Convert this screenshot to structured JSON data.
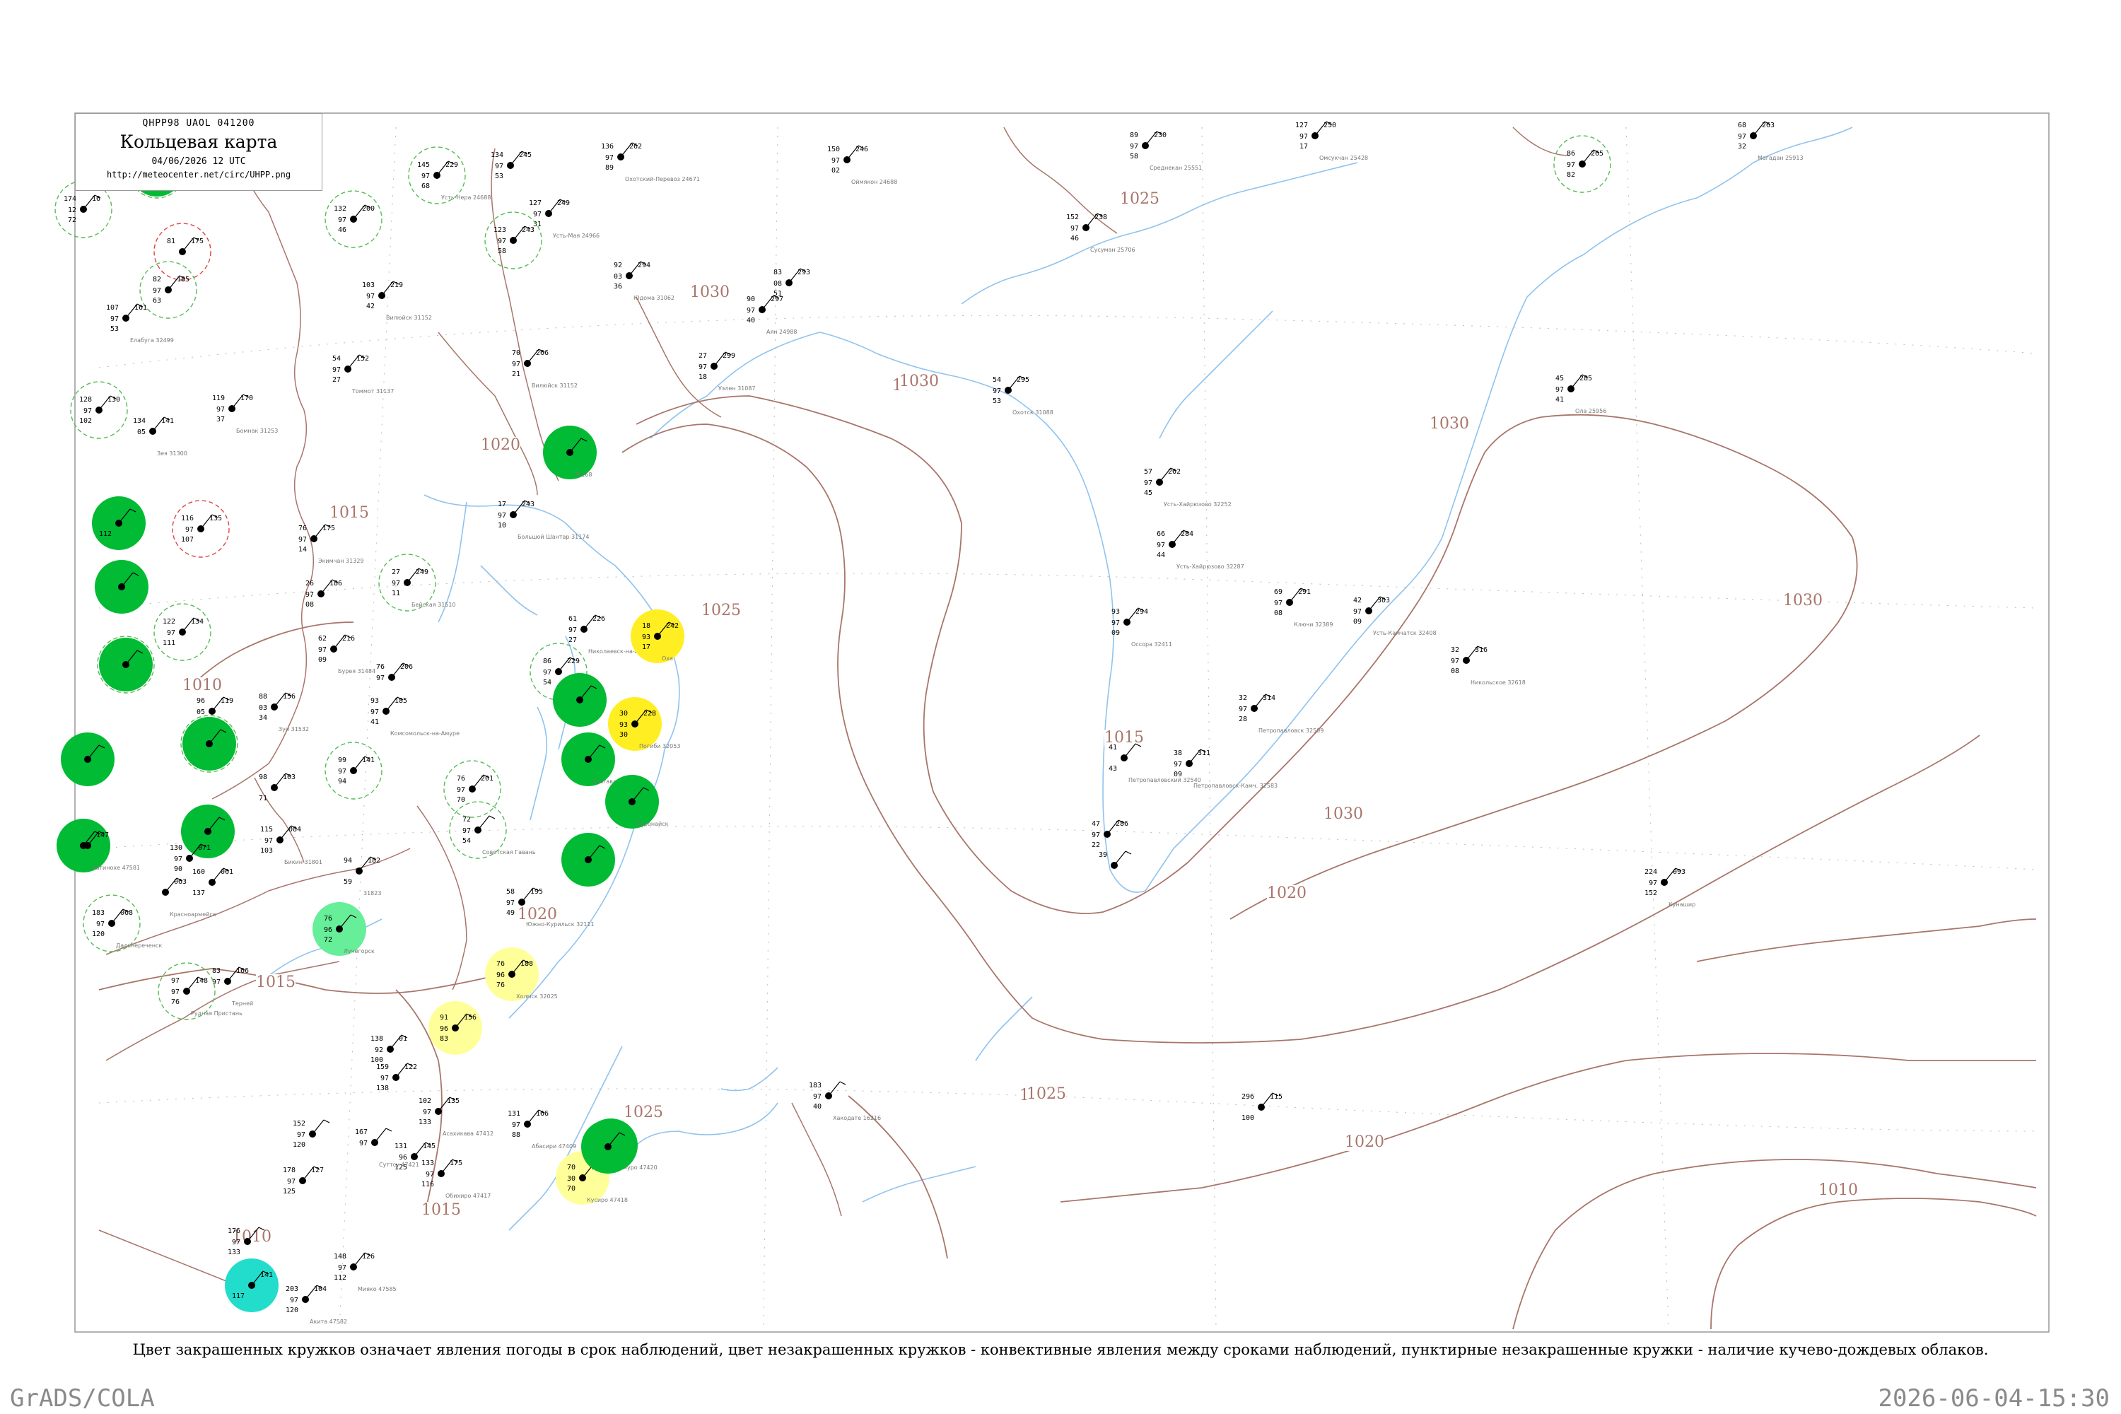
{
  "header": {
    "code": "QHPP98  UAOL  041200",
    "title": "Кольцевая карта",
    "date": "04/06/2026 12 UTC",
    "url": "http://meteocenter.net/circ/UHPP.png"
  },
  "caption": "Цвет закрашенных кружков означает явления погоды в срок наблюдений, цвет незакрашенных кружков - конвективные явления между сроками наблюдений, пунктирные незакрашенные кружки - наличие кучево-дождевых облаков.",
  "footer": {
    "left": "GrADS/COLA",
    "right": "2026-06-04-15:30"
  },
  "colors": {
    "isobar": "#a9756a",
    "coast": "#8fc3ee",
    "river": "#8fc3ee",
    "frame": "#999999",
    "rain_green": "#00bb33",
    "drizzle_light_green": "#66ee99",
    "fog_yellow": "#ffee22",
    "haze_light_yellow": "#ffff99",
    "snow_cyan": "#22ddcc",
    "cb_dashed": "#55bb55",
    "convective_red": "#dd4444"
  },
  "isobar_labels": [
    "1030",
    "1025",
    "1020",
    "1015",
    "1010",
    "1030",
    "1030",
    "1030",
    "1025",
    "1025",
    "1025",
    "1020",
    "1015",
    "1015",
    "1030",
    "1020",
    "1010",
    "1030",
    "1015",
    "1010",
    "1020",
    "1025"
  ],
  "stations": [
    {
      "id": "s1",
      "t": "174",
      "p": "16",
      "td": "72",
      "w": "12",
      "name": "",
      "fill": "none",
      "ring": "cb"
    },
    {
      "id": "s2",
      "t": "81",
      "p": "175",
      "td": "",
      "w": "",
      "name": "",
      "fill": "none",
      "ring": "red"
    },
    {
      "id": "s3",
      "t": "82",
      "p": "185",
      "td": "63",
      "w": "97",
      "name": "",
      "fill": "none",
      "ring": "cb"
    },
    {
      "id": "s4",
      "t": "107",
      "p": "161",
      "td": "53",
      "w": "97",
      "name": "Елабуга 32499",
      "fill": "none",
      "ring": ""
    },
    {
      "id": "s5",
      "t": "",
      "p": "",
      "td": "",
      "w": "",
      "name": "",
      "fill": "green",
      "ring": "cb"
    },
    {
      "id": "s6",
      "t": "145",
      "p": "229",
      "td": "68",
      "w": "97",
      "name": "Усть-Нера 24688",
      "fill": "none",
      "ring": "cb"
    },
    {
      "id": "s7",
      "t": "132",
      "p": "200",
      "td": "46",
      "w": "97",
      "name": "",
      "fill": "none",
      "ring": "cb"
    },
    {
      "id": "s8",
      "t": "134",
      "p": "245",
      "td": "53",
      "w": "97",
      "name": "",
      "fill": "none",
      "ring": ""
    },
    {
      "id": "s9",
      "t": "136",
      "p": "262",
      "td": "89",
      "w": "97",
      "name": "Охотский-Перевоз 24671",
      "fill": "none",
      "ring": ""
    },
    {
      "id": "s10",
      "t": "127",
      "p": "249",
      "td": "31",
      "w": "97",
      "name": "Усть-Мая 24966",
      "fill": "none",
      "ring": ""
    },
    {
      "id": "s11",
      "t": "123",
      "p": "243",
      "td": "58",
      "w": "97",
      "name": "",
      "fill": "none",
      "ring": "cb"
    },
    {
      "id": "s12",
      "t": "103",
      "p": "219",
      "td": "42",
      "w": "97",
      "name": "Вилюйск 31152",
      "fill": "none",
      "ring": ""
    },
    {
      "id": "s13",
      "t": "92",
      "p": "294",
      "td": "36",
      "w": "03",
      "name": "Юдома 31062",
      "fill": "none",
      "ring": ""
    },
    {
      "id": "s14",
      "t": "90",
      "p": "297",
      "td": "40",
      "w": "97",
      "name": "Аян 24988",
      "fill": "none",
      "ring": ""
    },
    {
      "id": "s15",
      "t": "83",
      "p": "293",
      "td": "51",
      "w": "08",
      "name": "",
      "fill": "none",
      "ring": ""
    },
    {
      "id": "s16",
      "t": "150",
      "p": "246",
      "td": "02",
      "w": "97",
      "name": "Оймякон 24688",
      "fill": "none",
      "ring": ""
    },
    {
      "id": "s17",
      "t": "89",
      "p": "230",
      "td": "58",
      "w": "97",
      "name": "Среднекан 25551",
      "fill": "none",
      "ring": ""
    },
    {
      "id": "s18",
      "t": "127",
      "p": "250",
      "td": "17",
      "w": "97",
      "name": "Омсукчан 25428",
      "fill": "none",
      "ring": ""
    },
    {
      "id": "s19",
      "t": "68",
      "p": "263",
      "td": "32",
      "w": "97",
      "name": "Магадан 25913",
      "fill": "none",
      "ring": ""
    },
    {
      "id": "s20",
      "t": "86",
      "p": "265",
      "td": "82",
      "w": "97",
      "name": "",
      "fill": "none",
      "ring": "cb"
    },
    {
      "id": "s21",
      "t": "152",
      "p": "238",
      "td": "46",
      "w": "97",
      "name": "Сусуман 25706",
      "fill": "none",
      "ring": ""
    },
    {
      "id": "s22",
      "t": "27",
      "p": "299",
      "td": "18",
      "w": "97",
      "name": "Уэлен 31087",
      "fill": "none",
      "ring": ""
    },
    {
      "id": "s23",
      "t": "54",
      "p": "295",
      "td": "53",
      "w": "97",
      "name": "Охотск 31088",
      "fill": "none",
      "ring": ""
    },
    {
      "id": "s24",
      "t": "70",
      "p": "266",
      "td": "21",
      "w": "97",
      "name": "Вилюйск 31152",
      "fill": "none",
      "ring": ""
    },
    {
      "id": "s25",
      "t": "54",
      "p": "152",
      "td": "27",
      "w": "97",
      "name": "Томмот 31137",
      "fill": "none",
      "ring": ""
    },
    {
      "id": "s26",
      "t": "45",
      "p": "285",
      "td": "41",
      "w": "97",
      "name": "Ола 25956",
      "fill": "none",
      "ring": ""
    },
    {
      "id": "s27",
      "t": "128",
      "p": "130",
      "td": "102",
      "w": "97",
      "name": "",
      "fill": "none",
      "ring": "cb"
    },
    {
      "id": "s28",
      "t": "134",
      "p": "141",
      "td": "",
      "w": "05",
      "name": "Зея 31300",
      "fill": "none",
      "ring": ""
    },
    {
      "id": "s29",
      "t": "119",
      "p": "170",
      "td": "37",
      "w": "97",
      "name": "Бомнак 31253",
      "fill": "none",
      "ring": ""
    },
    {
      "id": "s30",
      "t": "",
      "p": "",
      "td": "",
      "w": "",
      "name": "31168",
      "fill": "green",
      "ring": ""
    },
    {
      "id": "s31",
      "t": "",
      "p": "",
      "td": "112",
      "w": "",
      "name": "",
      "fill": "green",
      "ring": ""
    },
    {
      "id": "s32",
      "t": "116",
      "p": "135",
      "td": "107",
      "w": "97",
      "name": "",
      "fill": "none",
      "ring": "red"
    },
    {
      "id": "s33",
      "t": "76",
      "p": "175",
      "td": "14",
      "w": "97",
      "name": "Экимчан 31329",
      "fill": "none",
      "ring": ""
    },
    {
      "id": "s34",
      "t": "17",
      "p": "243",
      "td": "10",
      "w": "97",
      "name": "Большой Шантар 31174",
      "fill": "none",
      "ring": ""
    },
    {
      "id": "s35",
      "t": "57",
      "p": "262",
      "td": "45",
      "w": "97",
      "name": "Усть-Хайрюзово 32252",
      "fill": "none",
      "ring": ""
    },
    {
      "id": "s36",
      "t": "66",
      "p": "284",
      "td": "44",
      "w": "97",
      "name": "Усть-Хайрюзово 32287",
      "fill": "none",
      "ring": ""
    },
    {
      "id": "s37",
      "t": "",
      "p": "",
      "td": "",
      "w": "",
      "name": "",
      "fill": "green",
      "ring": ""
    },
    {
      "id": "s38",
      "t": "26",
      "p": "186",
      "td": "08",
      "w": "97",
      "name": "",
      "fill": "none",
      "ring": ""
    },
    {
      "id": "s39",
      "t": "27",
      "p": "249",
      "td": "11",
      "w": "97",
      "name": "Бейская 31510",
      "fill": "none",
      "ring": "cb"
    },
    {
      "id": "s40",
      "t": "61",
      "p": "226",
      "td": "27",
      "w": "97",
      "name": "Николаевск-на-Амуре",
      "fill": "none",
      "ring": ""
    },
    {
      "id": "s41",
      "t": "18",
      "p": "242",
      "td": "17",
      "w": "93",
      "name": "Оха",
      "fill": "yellow",
      "ring": ""
    },
    {
      "id": "s42",
      "t": "93",
      "p": "294",
      "td": "09",
      "w": "97",
      "name": "Оссора 32411",
      "fill": "none",
      "ring": ""
    },
    {
      "id": "s43",
      "t": "69",
      "p": "291",
      "td": "08",
      "w": "97",
      "name": "Ключи 32389",
      "fill": "none",
      "ring": ""
    },
    {
      "id": "s44",
      "t": "42",
      "p": "303",
      "td": "09",
      "w": "97",
      "name": "Усть-Камчатск 32408",
      "fill": "none",
      "ring": ""
    },
    {
      "id": "s45",
      "t": "32",
      "p": "316",
      "td": "08",
      "w": "97",
      "name": "Никольское 32618",
      "fill": "none",
      "ring": ""
    },
    {
      "id": "s46",
      "t": "",
      "p": "",
      "td": "",
      "w": "",
      "name": "",
      "fill": "green",
      "ring": "cb"
    },
    {
      "id": "s47",
      "t": "122",
      "p": "134",
      "td": "111",
      "w": "97",
      "name": "",
      "fill": "none",
      "ring": "cb"
    },
    {
      "id": "s48",
      "t": "62",
      "p": "216",
      "td": "09",
      "w": "97",
      "name": "Бурея 31484",
      "fill": "none",
      "ring": ""
    },
    {
      "id": "s49",
      "t": "76",
      "p": "206",
      "td": "",
      "w": "97",
      "name": "",
      "fill": "none",
      "ring": ""
    },
    {
      "id": "s50",
      "t": "86",
      "p": "229",
      "td": "54",
      "w": "97",
      "name": "",
      "fill": "none",
      "ring": "cb"
    },
    {
      "id": "s51",
      "t": "",
      "p": "",
      "td": "",
      "w": "",
      "name": "",
      "fill": "green",
      "ring": ""
    },
    {
      "id": "s52",
      "t": "96",
      "p": "119",
      "td": "",
      "w": "05",
      "name": "",
      "fill": "none",
      "ring": ""
    },
    {
      "id": "s53",
      "t": "88",
      "p": "156",
      "td": "34",
      "w": "03",
      "name": "Зуи 31532",
      "fill": "none",
      "ring": ""
    },
    {
      "id": "s54",
      "t": "93",
      "p": "185",
      "td": "41",
      "w": "97",
      "name": "Комсомольск-на-Амуре",
      "fill": "none",
      "ring": ""
    },
    {
      "id": "s55",
      "t": "30",
      "p": "228",
      "td": "30",
      "w": "93",
      "name": "Погиби 32053",
      "fill": "yellow",
      "ring": ""
    },
    {
      "id": "s56",
      "t": "32",
      "p": "314",
      "td": "28",
      "w": "97",
      "name": "Петропавловск 32509",
      "fill": "none",
      "ring": ""
    },
    {
      "id": "s57",
      "t": "41",
      "p": "",
      "td": "43",
      "w": "",
      "name": "Петропавловский 32540",
      "fill": "none",
      "ring": ""
    },
    {
      "id": "s58",
      "t": "38",
      "p": "311",
      "td": "09",
      "w": "97",
      "name": "Петропавловск-Камч. 32583",
      "fill": "none",
      "ring": ""
    },
    {
      "id": "s59",
      "t": "",
      "p": "",
      "td": "",
      "w": "",
      "name": "",
      "fill": "green",
      "ring": ""
    },
    {
      "id": "s60",
      "t": "",
      "p": "",
      "td": "",
      "w": "",
      "name": "",
      "fill": "green",
      "ring": "cb"
    },
    {
      "id": "s61",
      "t": "99",
      "p": "141",
      "td": "94",
      "w": "97",
      "name": "",
      "fill": "none",
      "ring": "cb"
    },
    {
      "id": "s62",
      "t": "98",
      "p": "103",
      "td": "71",
      "w": "",
      "name": "",
      "fill": "none",
      "ring": ""
    },
    {
      "id": "s63",
      "t": "",
      "p": "",
      "td": "",
      "w": "",
      "name": "",
      "fill": "green",
      "ring": ""
    },
    {
      "id": "s64",
      "t": "76",
      "p": "201",
      "td": "70",
      "w": "97",
      "name": "",
      "fill": "none",
      "ring": "cb"
    },
    {
      "id": "s65",
      "t": "",
      "p": "",
      "td": "",
      "w": "",
      "name": "Совгавань",
      "fill": "green",
      "ring": ""
    },
    {
      "id": "s66",
      "t": "",
      "p": "",
      "td": "",
      "w": "",
      "name": "Поронайск",
      "fill": "green",
      "ring": ""
    },
    {
      "id": "s67",
      "t": "115",
      "p": "084",
      "td": "103",
      "w": "97",
      "name": "Бикин 31801",
      "fill": "none",
      "ring": ""
    },
    {
      "id": "s68",
      "t": "",
      "p": "",
      "td": "",
      "w": "",
      "name": "",
      "fill": "green",
      "ring": ""
    },
    {
      "id": "s69",
      "t": "130",
      "p": "071",
      "td": "90",
      "w": "97",
      "name": "",
      "fill": "none",
      "ring": ""
    },
    {
      "id": "s70",
      "t": "72",
      "p": "",
      "td": "54",
      "w": "97",
      "name": "Советская Гавань",
      "fill": "none",
      "ring": "cb"
    },
    {
      "id": "s71",
      "t": "47",
      "p": "286",
      "td": "22",
      "w": "97",
      "name": "",
      "fill": "none",
      "ring": ""
    },
    {
      "id": "s72",
      "t": "39",
      "p": "",
      "td": "",
      "w": "",
      "name": "",
      "fill": "none",
      "ring": ""
    },
    {
      "id": "s73",
      "t": "",
      "p": "",
      "td": "",
      "w": "",
      "name": "",
      "fill": "green",
      "ring": ""
    },
    {
      "id": "s74",
      "t": "94",
      "p": "182",
      "td": "59",
      "w": "",
      "name": "31823",
      "fill": "none",
      "ring": ""
    },
    {
      "id": "s75",
      "t": "160",
      "p": "061",
      "td": "137",
      "w": "",
      "name": "",
      "fill": "none",
      "ring": ""
    },
    {
      "id": "s76",
      "t": "",
      "p": "063",
      "td": "",
      "w": "",
      "name": "Красноармейск",
      "fill": "none",
      "ring": ""
    },
    {
      "id": "s77",
      "t": "183",
      "p": "068",
      "td": "120",
      "w": "97",
      "name": "Дальнереченск",
      "fill": "none",
      "ring": "cb"
    },
    {
      "id": "s78",
      "t": "224",
      "p": "093",
      "td": "152",
      "w": "97",
      "name": "Кунашир",
      "fill": "none",
      "ring": ""
    },
    {
      "id": "s79",
      "t": "58",
      "p": "195",
      "td": "49",
      "w": "97",
      "name": "Южно-Курильск 32111",
      "fill": "none",
      "ring": ""
    },
    {
      "id": "s80",
      "t": "76",
      "p": "",
      "td": "72",
      "w": "96",
      "name": "Лучегорск",
      "fill": "light_green",
      "ring": ""
    },
    {
      "id": "s81",
      "t": "76",
      "p": "188",
      "td": "76",
      "w": "96",
      "name": "Холмск 32025",
      "fill": "light_yellow",
      "ring": ""
    },
    {
      "id": "s82",
      "t": "83",
      "p": "166",
      "td": "",
      "w": "97",
      "name": "Терней",
      "fill": "none",
      "ring": ""
    },
    {
      "id": "s83",
      "t": "97",
      "p": "148",
      "td": "76",
      "w": "97",
      "name": "Рудная Пристань",
      "fill": "none",
      "ring": "cb"
    },
    {
      "id": "s84",
      "t": "91",
      "p": "156",
      "td": "83",
      "w": "96",
      "name": "",
      "fill": "light_yellow",
      "ring": ""
    },
    {
      "id": "s85",
      "t": "138",
      "p": "01",
      "td": "100",
      "w": "92",
      "name": "",
      "fill": "none",
      "ring": ""
    },
    {
      "id": "s86",
      "t": "159",
      "p": "122",
      "td": "138",
      "w": "97",
      "name": "",
      "fill": "none",
      "ring": ""
    },
    {
      "id": "s87",
      "t": "102",
      "p": "135",
      "td": "133",
      "w": "97",
      "name": "Асахикава 47412",
      "fill": "none",
      "ring": ""
    },
    {
      "id": "s88",
      "t": "183",
      "p": "",
      "td": "40",
      "w": "97",
      "name": "Хакодате 16216",
      "fill": "none",
      "ring": ""
    },
    {
      "id": "s89",
      "t": "296",
      "p": "115",
      "td": "100",
      "w": "",
      "name": "",
      "fill": "none",
      "ring": ""
    },
    {
      "id": "s90",
      "t": "131",
      "p": "166",
      "td": "88",
      "w": "97",
      "name": "Абасири 47409",
      "fill": "none",
      "ring": ""
    },
    {
      "id": "s91",
      "t": "",
      "p": "",
      "td": "",
      "w": "",
      "name": "Немуро 47420",
      "fill": "green",
      "ring": ""
    },
    {
      "id": "s92",
      "t": "70",
      "p": "167",
      "td": "70",
      "w": "30",
      "name": "Кусиро 47418",
      "fill": "light_yellow",
      "ring": ""
    },
    {
      "id": "s93",
      "t": "152",
      "p": "",
      "td": "120",
      "w": "97",
      "name": "",
      "fill": "none",
      "ring": ""
    },
    {
      "id": "s94",
      "t": "167",
      "p": "",
      "td": "",
      "w": "97",
      "name": "Суттсу 47421",
      "fill": "none",
      "ring": ""
    },
    {
      "id": "s95",
      "t": "131",
      "p": "145",
      "td": "125",
      "w": "96",
      "name": "",
      "fill": "none",
      "ring": ""
    },
    {
      "id": "s96",
      "t": "133",
      "p": "175",
      "td": "116",
      "w": "97",
      "name": "Обихиро 47417",
      "fill": "none",
      "ring": ""
    },
    {
      "id": "s97",
      "t": "178",
      "p": "127",
      "td": "125",
      "w": "97",
      "name": "",
      "fill": "none",
      "ring": ""
    },
    {
      "id": "s98",
      "t": "176",
      "p": "",
      "td": "133",
      "w": "97",
      "name": "",
      "fill": "none",
      "ring": ""
    },
    {
      "id": "s99",
      "t": "",
      "p": "141",
      "td": "117",
      "w": "",
      "name": "",
      "fill": "cyan",
      "ring": ""
    },
    {
      "id": "s100",
      "t": "203",
      "p": "104",
      "td": "120",
      "w": "97",
      "name": "Акита 47582",
      "fill": "none",
      "ring": ""
    },
    {
      "id": "s101",
      "t": "148",
      "p": "126",
      "td": "112",
      "w": "97",
      "name": "Мияко 47585",
      "fill": "none",
      "ring": ""
    },
    {
      "id": "s102",
      "t": "",
      "p": "147",
      "td": "",
      "w": "",
      "name": "Хатинохе 47581",
      "fill": "none",
      "ring": ""
    },
    {
      "id": "s103",
      "t": "",
      "p": "",
      "td": "",
      "w": "",
      "name": "",
      "fill": "green",
      "ring": ""
    },
    {
      "id": "s104",
      "t": "",
      "p": "",
      "td": "",
      "w": "",
      "name": "",
      "fill": "green",
      "ring": ""
    }
  ]
}
